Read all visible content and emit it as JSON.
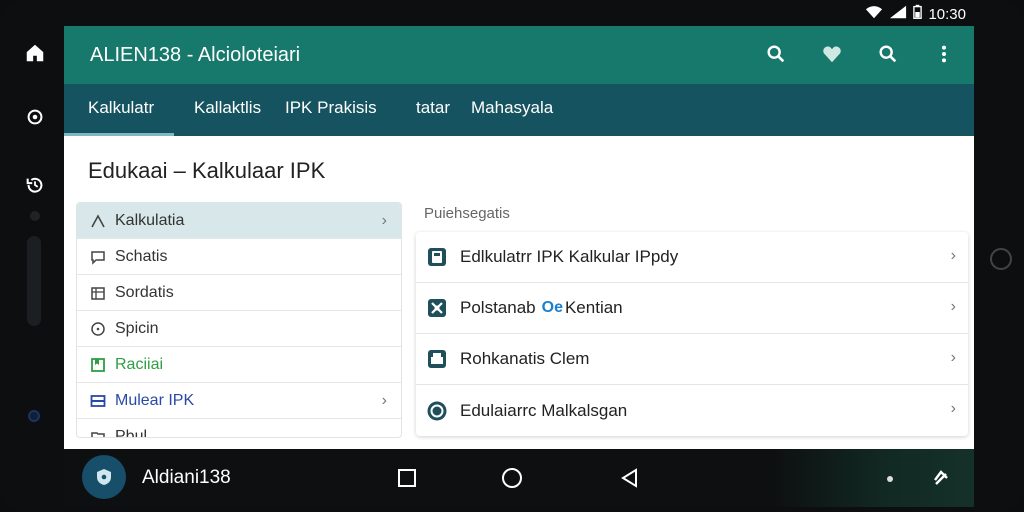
{
  "status": {
    "time": "10:30"
  },
  "app": {
    "title": "ALIEN138 - Alcioloteiari"
  },
  "tabs": [
    {
      "label": "Kalkulatr"
    },
    {
      "label": "Kallaktlis"
    },
    {
      "label": "IPK Prakisis"
    },
    {
      "label": "tatar"
    },
    {
      "label": "Mahasyala"
    }
  ],
  "page": {
    "title": "Edukaai – Kalkulaar IPK"
  },
  "left_list": [
    {
      "label": "Kalkulatia",
      "icon": "chart-icon"
    },
    {
      "label": "Schatis",
      "icon": "chat-icon"
    },
    {
      "label": "Sordatis",
      "icon": "calendar-icon"
    },
    {
      "label": "Spicin",
      "icon": "clock-icon"
    },
    {
      "label": "Raciiai",
      "icon": "bookmark-icon"
    },
    {
      "label": "Mulear IPK",
      "icon": "card-icon"
    },
    {
      "label": "Pbul",
      "icon": "folder-icon"
    }
  ],
  "right_section": {
    "caption": "Puiehsegatis",
    "items": [
      {
        "label": "Edlkulatrr IPK Kalkular IPpdy",
        "icon": "calculator-icon"
      },
      {
        "label": "Polstanab",
        "extra": "Oe",
        "label2": "Kentian",
        "icon": "network-icon"
      },
      {
        "label": "Rohkanatis Clem",
        "icon": "printer-icon"
      },
      {
        "label": "Edulaiarrc Malkalsgan",
        "icon": "shield-icon"
      }
    ]
  },
  "navbar": {
    "app_label": "Aldiani138"
  },
  "colors": {
    "appbar": "#17796b",
    "tabbar": "#14535f",
    "accent_green": "#2e9e46",
    "accent_blue": "#2949a8"
  }
}
